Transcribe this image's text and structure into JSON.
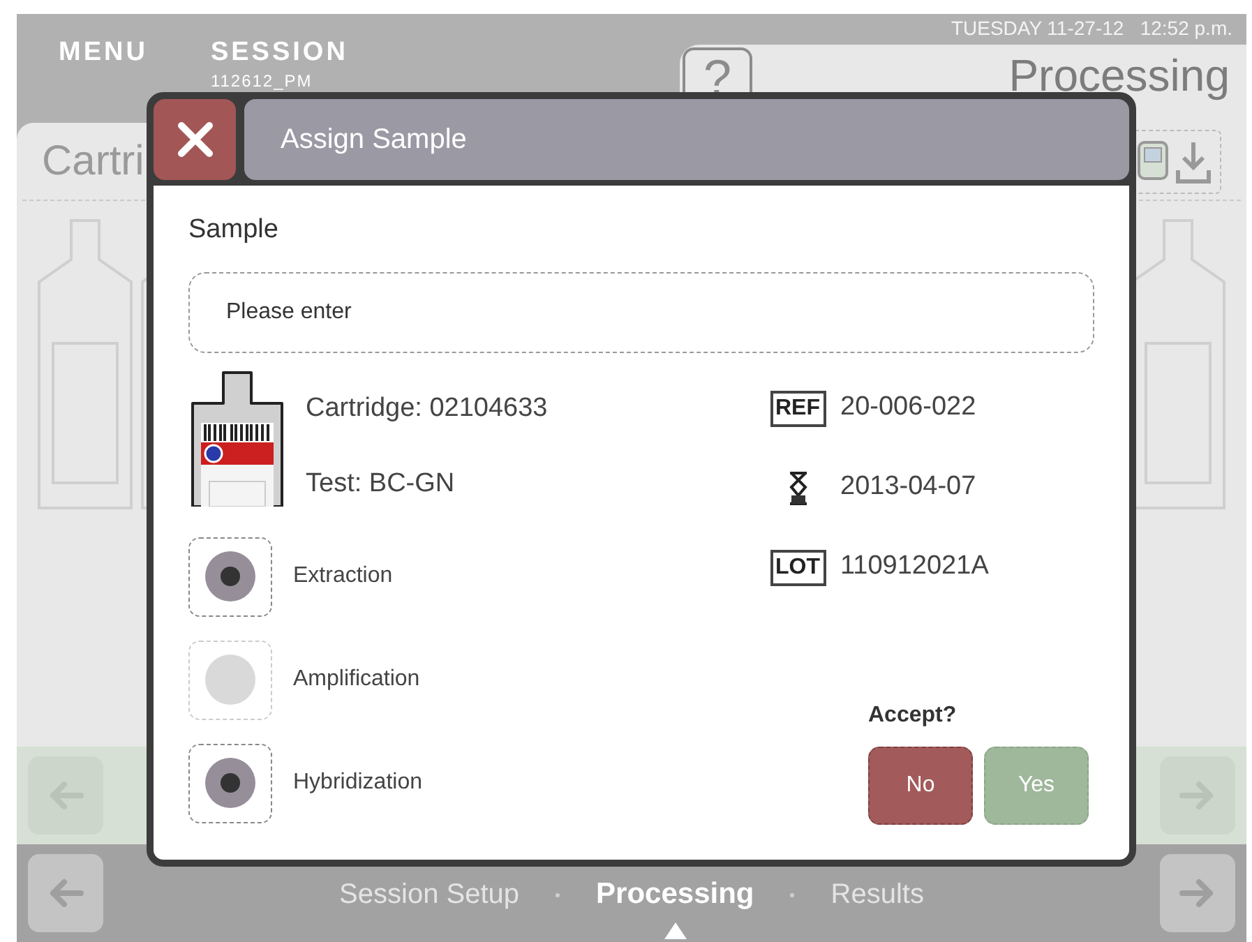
{
  "top_bar": {
    "menu": "MENU",
    "session_label": "SESSION",
    "session_id": "112612_PM",
    "datetime": "TUESDAY 11-27-12   12:52 p.m."
  },
  "header": {
    "help": "?",
    "title": "Processing"
  },
  "panel": {
    "title": "Cartri"
  },
  "steps": [
    {
      "label": "Session Setup",
      "selected": false
    },
    {
      "label": "Processing",
      "selected": true
    },
    {
      "label": "Results",
      "selected": false
    }
  ],
  "dialog": {
    "title": "Assign Sample",
    "sample_label": "Sample",
    "sample_field": {
      "placeholder": "Please enter"
    },
    "cartridge": "Cartridge: 02104633",
    "test": "Test: BC-GN",
    "info": [
      {
        "kind": "ref",
        "badge": "REF",
        "value": "20-006-022"
      },
      {
        "kind": "expiry",
        "value": "2013-04-07"
      },
      {
        "kind": "lot",
        "badge": "LOT",
        "value": "110912021A"
      }
    ],
    "stages": [
      {
        "label": "Extraction",
        "checked": true
      },
      {
        "label": "Amplification",
        "checked": false
      },
      {
        "label": "Hybridization",
        "checked": true
      }
    ],
    "accept_label": "Accept?",
    "buttons": [
      {
        "label": "No",
        "kind": "reject"
      },
      {
        "label": "Yes",
        "kind": "confirm"
      }
    ]
  }
}
